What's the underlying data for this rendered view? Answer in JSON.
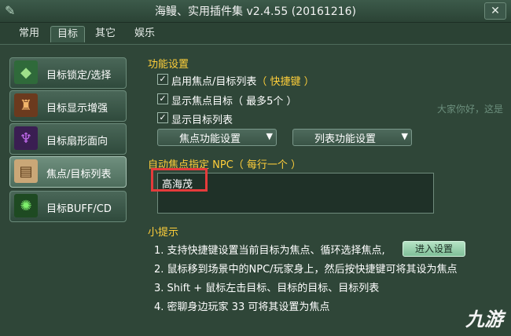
{
  "window": {
    "title": "海鳗、实用插件集 v2.4.55 (20161216)",
    "close_glyph": "✕"
  },
  "tabs": [
    {
      "label": "常用"
    },
    {
      "label": "目标"
    },
    {
      "label": "其它"
    },
    {
      "label": "娱乐"
    }
  ],
  "sidebar": {
    "items": [
      {
        "label": "目标锁定/选择",
        "icon": "bag-icon"
      },
      {
        "label": "目标显示增强",
        "icon": "warrior-icon"
      },
      {
        "label": "目标扇形面向",
        "icon": "figure-icon"
      },
      {
        "label": "焦点/目标列表",
        "icon": "scroll-icon"
      },
      {
        "label": "目标BUFF/CD",
        "icon": "burst-icon"
      }
    ]
  },
  "main": {
    "function_settings_title": "功能设置",
    "checks": [
      {
        "label": "启用焦点/目标列表",
        "hint": "（ 快捷键 ）"
      },
      {
        "label": "显示焦点目标（ 最多5个 ）",
        "hint": ""
      },
      {
        "label": "显示目标列表",
        "hint": ""
      }
    ],
    "dropdowns": {
      "focus": "焦点功能设置",
      "list": "列表功能设置"
    },
    "npc_title": "自动焦点指定 NPC（ 每行一个 ）",
    "npc_value": "高海茂",
    "tips_title": "小提示",
    "tips": [
      "1. 支持快捷键设置当前目标为焦点、循环选择焦点,",
      "2. 鼠标移到场景中的NPC/玩家身上，然后按快捷键可将其设为焦点",
      "3. Shift + 鼠标左击目标、目标的目标、目标列表",
      "4. 密聊身边玩家 33 可将其设置为焦点"
    ],
    "enter_button": "进入设置"
  },
  "background": {
    "deco_text": "大家你好，这是"
  },
  "watermark": "九游"
}
